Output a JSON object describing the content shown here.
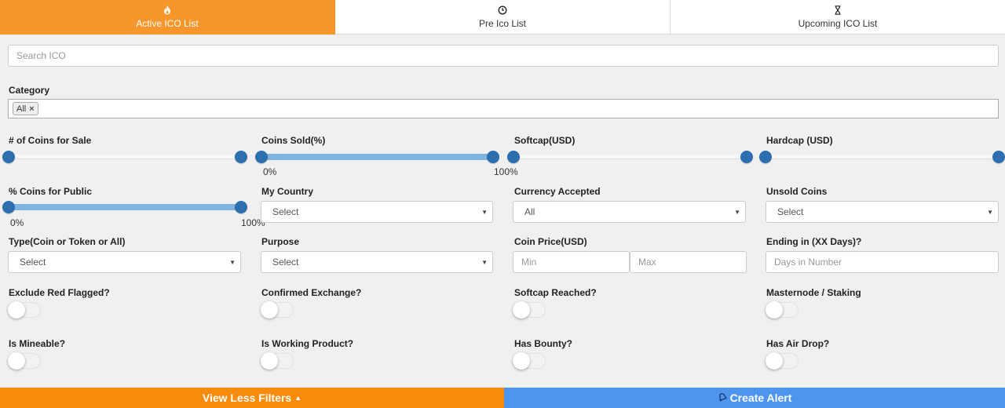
{
  "tabs": [
    {
      "label": "Active ICO List",
      "icon": "fire-icon",
      "glyph": "🔥",
      "active": true
    },
    {
      "label": "Pre Ico List",
      "icon": "clock-icon",
      "glyph": "◷",
      "active": false
    },
    {
      "label": "Upcoming ICO List",
      "icon": "hourglass-icon",
      "glyph": "⧗",
      "active": false
    }
  ],
  "search": {
    "placeholder": "Search ICO",
    "value": ""
  },
  "category": {
    "label": "Category",
    "chips": [
      {
        "label": "All",
        "remove": "×"
      }
    ]
  },
  "sliders": {
    "coins_for_sale": {
      "label": "# of Coins for Sale",
      "min_pct": 0,
      "max_pct": 100
    },
    "coins_sold": {
      "label": "Coins Sold(%)",
      "min_pct": 0,
      "max_pct": 100,
      "min_label": "0%",
      "max_label": "100%"
    },
    "softcap": {
      "label": "Softcap(USD)",
      "min_pct": 0,
      "max_pct": 100
    },
    "hardcap": {
      "label": "Hardcap (USD)",
      "min_pct": 0,
      "max_pct": 100
    },
    "coins_public": {
      "label": "% Coins for Public",
      "min_pct": 0,
      "max_pct": 100,
      "min_label": "0%",
      "max_label": "100%"
    }
  },
  "selects": {
    "my_country": {
      "label": "My Country",
      "value": "Select"
    },
    "currency": {
      "label": "Currency Accepted",
      "value": "All"
    },
    "unsold": {
      "label": "Unsold Coins",
      "value": "Select"
    },
    "type": {
      "label": "Type(Coin or Token or All)",
      "value": "Select"
    },
    "purpose": {
      "label": "Purpose",
      "value": "Select"
    }
  },
  "coin_price": {
    "label": "Coin Price(USD)",
    "min_placeholder": "Min",
    "max_placeholder": "Max"
  },
  "ending": {
    "label": "Ending in (XX Days)?",
    "placeholder": "Days in Number"
  },
  "toggles": [
    {
      "label": "Exclude Red Flagged?",
      "on": false
    },
    {
      "label": "Confirmed Exchange?",
      "on": false
    },
    {
      "label": "Softcap Reached?",
      "on": false
    },
    {
      "label": "Masternode / Staking",
      "on": false
    },
    {
      "label": "Is Mineable?",
      "on": false
    },
    {
      "label": "Is Working Product?",
      "on": false
    },
    {
      "label": "Has Bounty?",
      "on": false
    },
    {
      "label": "Has Air Drop?",
      "on": false
    }
  ],
  "bottom": {
    "less_label": "View Less Filters",
    "less_icon": "▲",
    "alert_label": "Create Alert",
    "alert_icon": "🔔"
  },
  "colors": {
    "active_tab": "#f7962b",
    "less_button": "#fa8b0c",
    "alert_button": "#4e95ef",
    "slider_handle": "#2d6fae",
    "slider_range": "#7fb3e3"
  }
}
